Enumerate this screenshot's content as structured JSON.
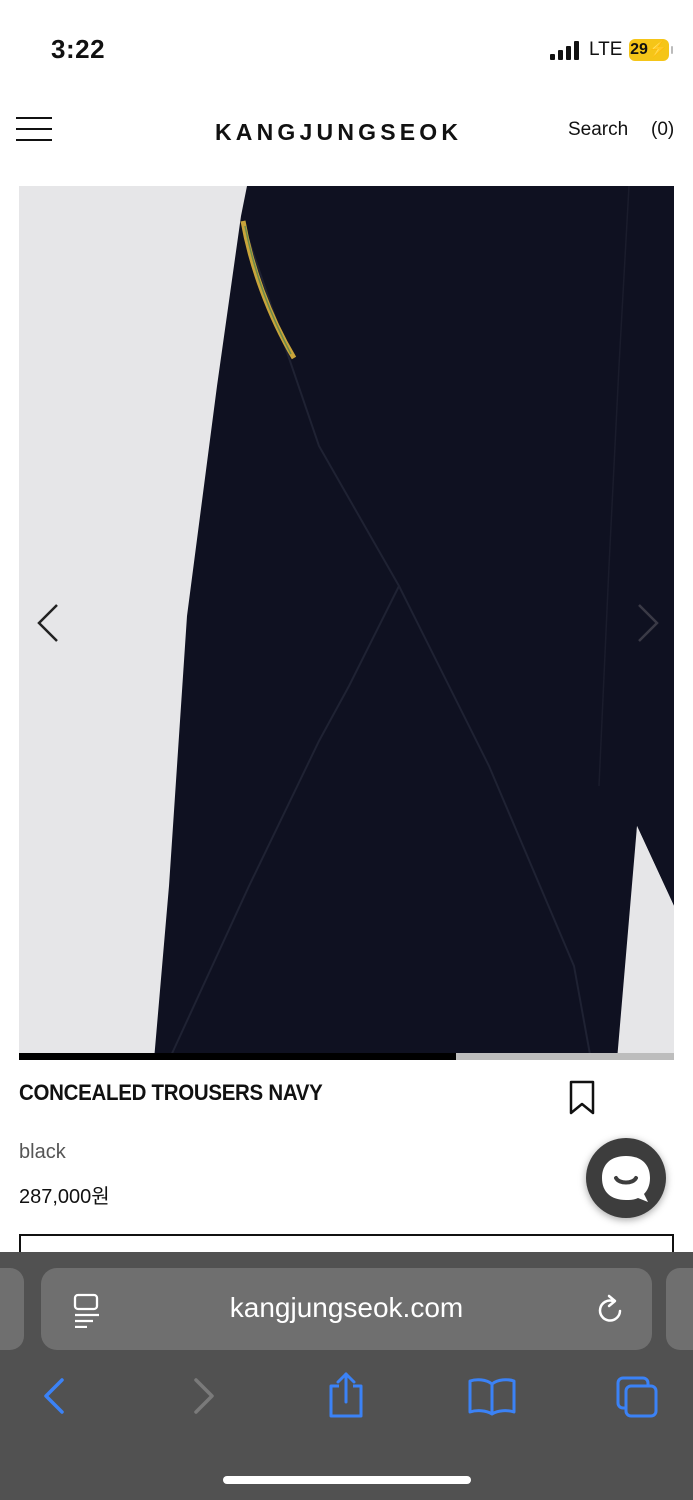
{
  "status_bar": {
    "time": "3:22",
    "network": "LTE",
    "battery": "29"
  },
  "header": {
    "menu_icon": "hamburger-menu-icon",
    "logo": "KANGJUNGSEOK",
    "search_label": "Search",
    "cart_label": "(0)"
  },
  "gallery": {
    "prev_icon": "chevron-left-icon",
    "next_icon": "chevron-right-icon",
    "progress_fraction": 0.667
  },
  "product": {
    "name": "CONCEALED TROUSERS NAVY",
    "color": "black",
    "price": "287,000원",
    "bookmark_icon": "bookmark-icon"
  },
  "chat_icon": "chat-bubble-icon",
  "browser": {
    "url": "kangjungseok.com",
    "page_menu_icon": "page-format-icon",
    "reload_icon": "reload-icon",
    "toolbar": [
      "back-icon",
      "forward-icon",
      "share-icon",
      "bookmarks-icon",
      "tabs-icon"
    ]
  },
  "colors": {
    "browser_bar": "#515151",
    "url_field": "#6f6f6f",
    "accent_blue": "#3b82f6",
    "battery": "#f5c518",
    "photo_bg": "#e6e6e8",
    "garment": "#0f1121"
  }
}
